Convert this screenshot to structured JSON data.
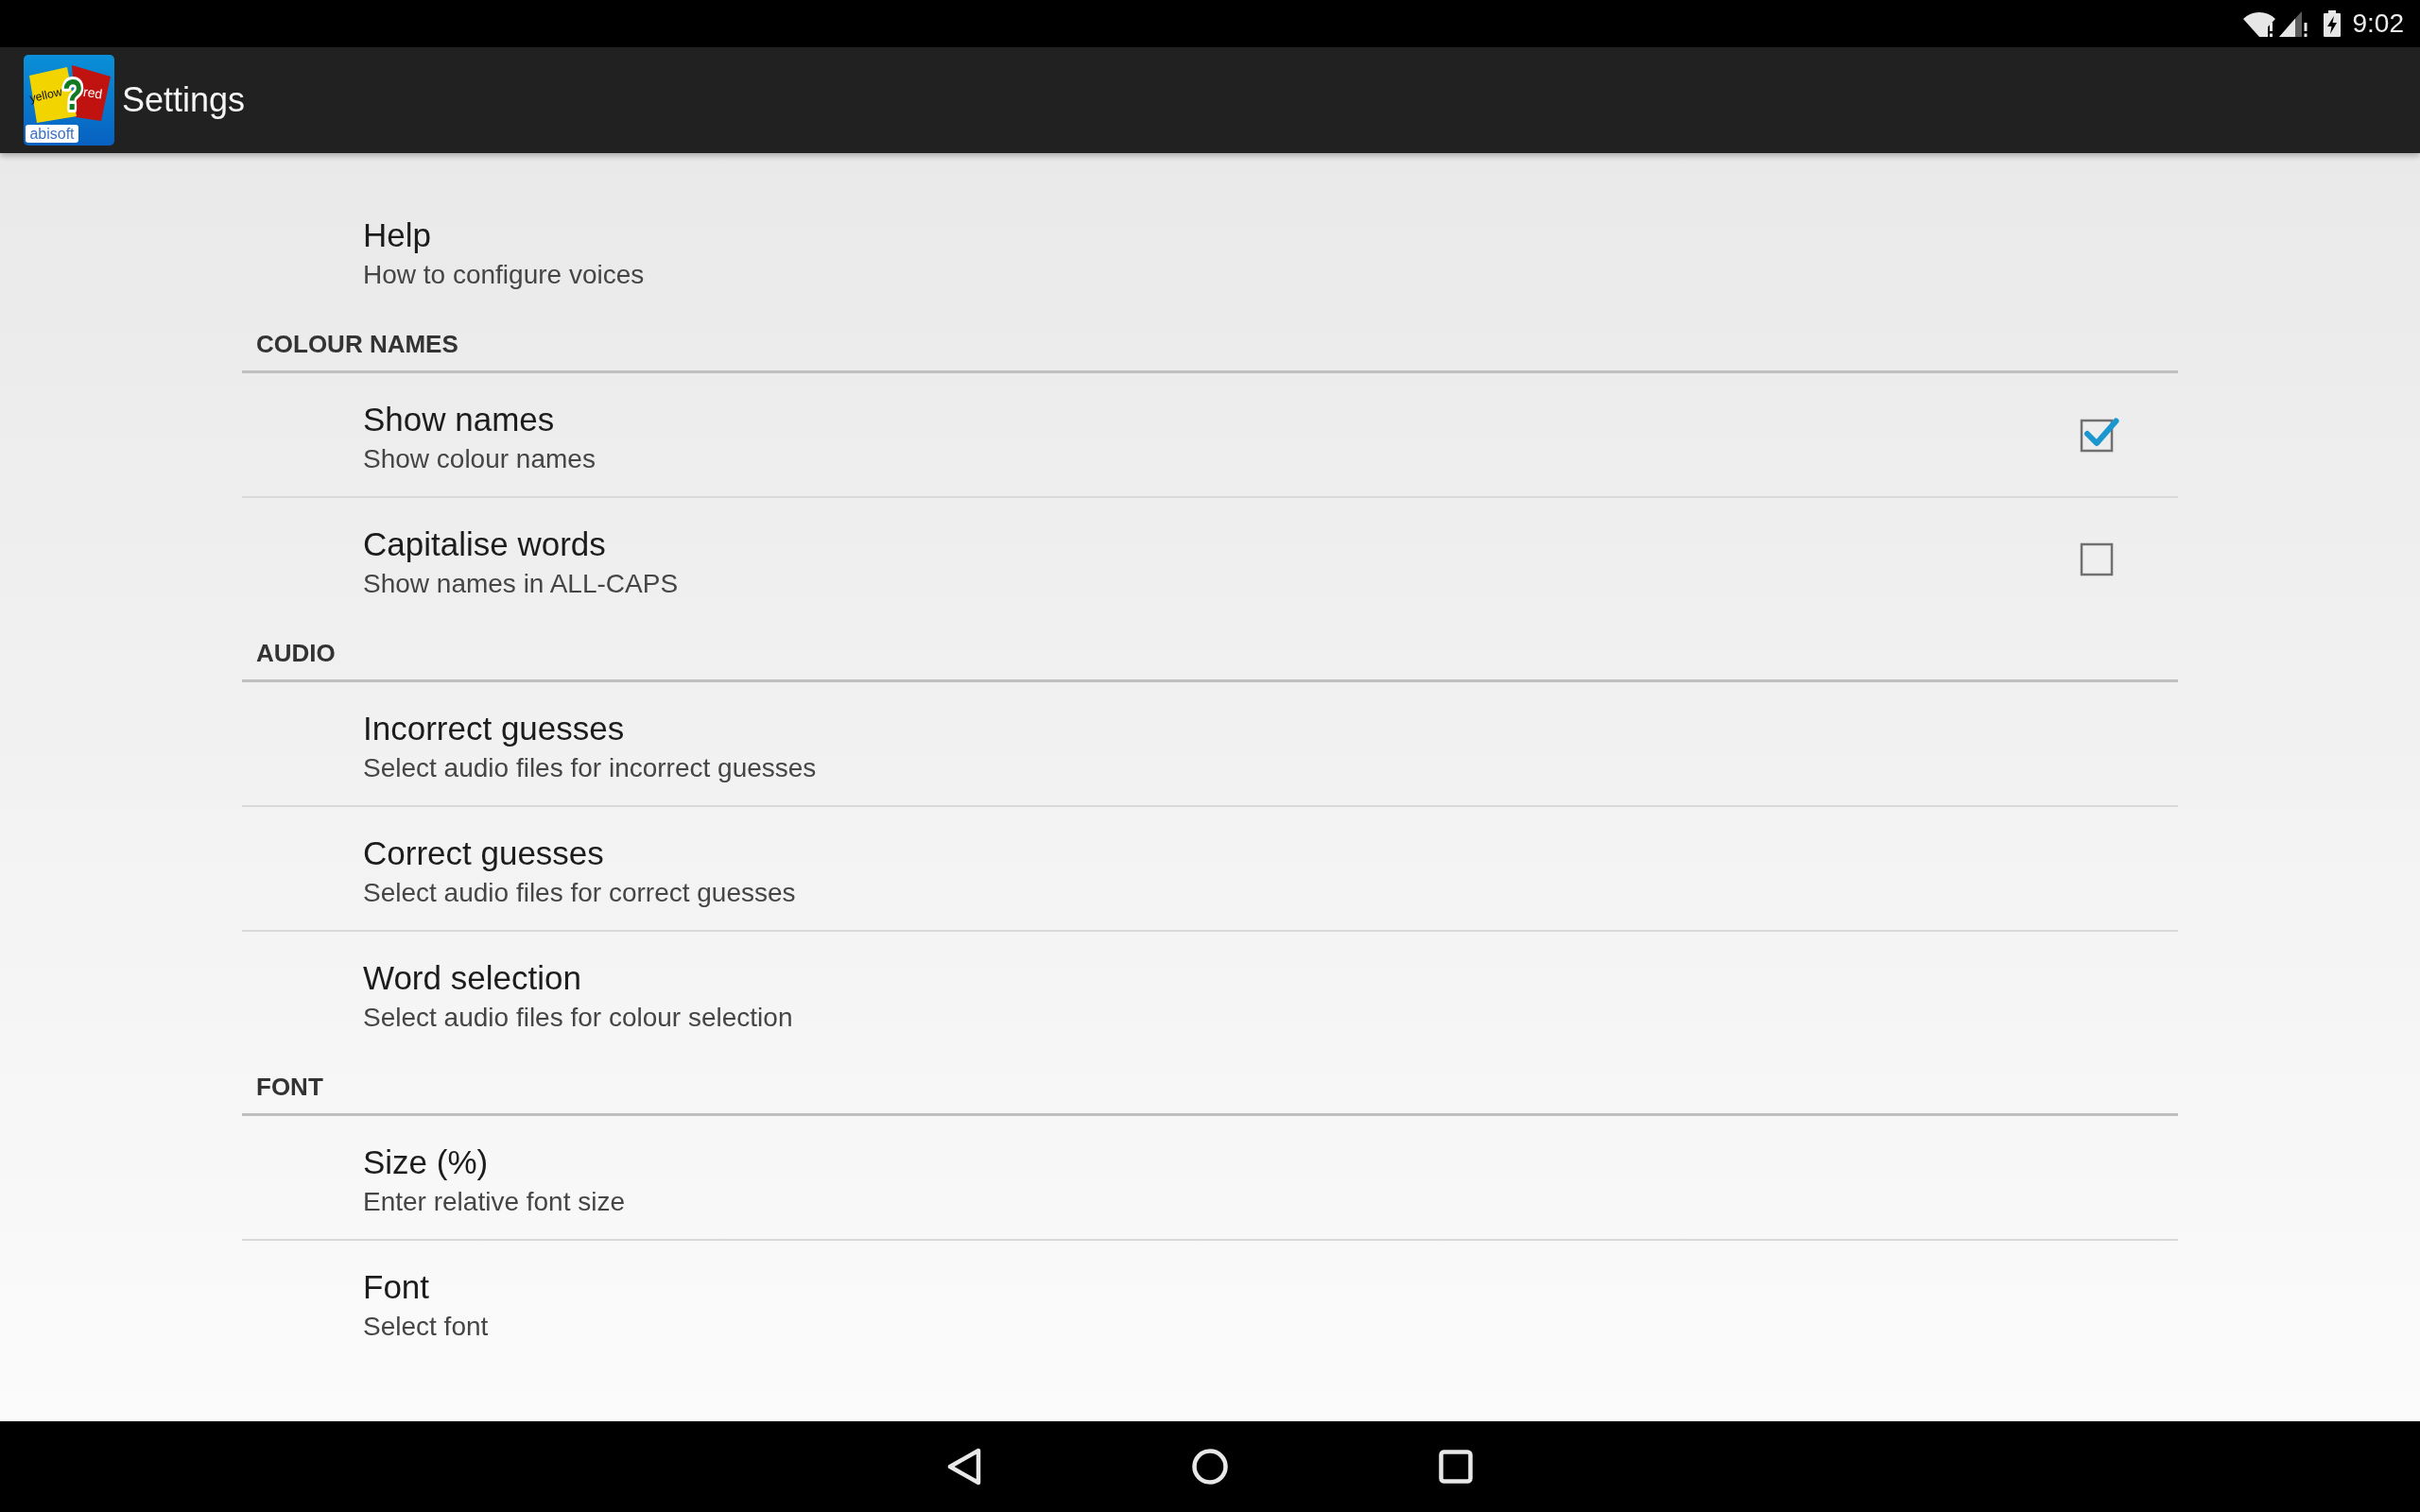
{
  "status_bar": {
    "time": "9:02"
  },
  "app_bar": {
    "icon": {
      "left_card": "yellow",
      "right_card": "red",
      "mark": "?",
      "brand": "abisoft"
    },
    "title": "Settings"
  },
  "preferences": [
    {
      "kind": "item",
      "title": "Help",
      "summary": "How to configure voices"
    },
    {
      "kind": "category",
      "title": "COLOUR NAMES",
      "items": [
        {
          "kind": "checkbox",
          "title": "Show names",
          "summary": "Show colour names",
          "checked": true
        },
        {
          "kind": "checkbox",
          "title": "Capitalise words",
          "summary": "Show names in ALL-CAPS",
          "checked": false
        }
      ]
    },
    {
      "kind": "category",
      "title": "AUDIO",
      "items": [
        {
          "kind": "item",
          "title": "Incorrect guesses",
          "summary": "Select audio files for incorrect guesses"
        },
        {
          "kind": "item",
          "title": "Correct guesses",
          "summary": "Select audio files for correct guesses"
        },
        {
          "kind": "item",
          "title": "Word selection",
          "summary": "Select audio files for colour selection"
        }
      ]
    },
    {
      "kind": "category",
      "title": "FONT",
      "items": [
        {
          "kind": "item",
          "title": "Size (%)",
          "summary": "Enter relative font size"
        },
        {
          "kind": "item",
          "title": "Font",
          "summary": "Select font"
        }
      ]
    }
  ]
}
